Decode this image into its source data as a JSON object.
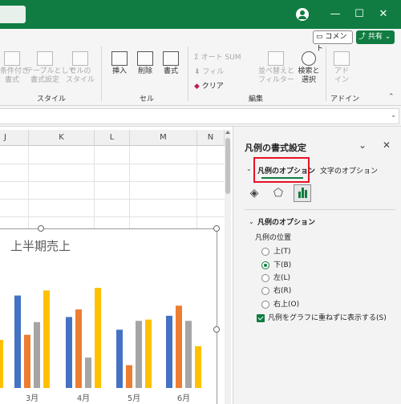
{
  "titlebar": {
    "minimize": "—",
    "maximize": "☐",
    "close": "✕"
  },
  "ribbon": {
    "comment_label": "コメント",
    "share_label": "共有",
    "items": {
      "conditional": "条件付き\n書式",
      "table": "テーブルとして\n書式設定",
      "cellstyle": "セルの\nスタイル",
      "insert": "挿入",
      "delete": "削除",
      "format": "書式",
      "autosum": "オート SUM",
      "fill": "フィル",
      "clear": "クリア",
      "sort": "並べ替えと\nフィルター",
      "find": "検索と\n選択",
      "addin": "アド\nイン"
    },
    "groups": {
      "style": "スタイル",
      "cells": "セル",
      "edit": "編集",
      "addin": "アドイン"
    }
  },
  "grid": {
    "columns": [
      "J",
      "K",
      "L",
      "M",
      "N"
    ]
  },
  "chart_data": {
    "type": "bar",
    "title": "上半期売上",
    "categories": [
      "3月",
      "4月",
      "5月",
      "6月"
    ],
    "series": [
      {
        "color": "#4472c4",
        "values": [
          730,
          560,
          460,
          570
        ]
      },
      {
        "color": "#ed7d31",
        "values": [
          420,
          620,
          180,
          650
        ]
      },
      {
        "color": "#a5a5a5",
        "values": [
          520,
          240,
          530,
          530
        ]
      },
      {
        "color": "#ffc000",
        "values": [
          770,
          790,
          540,
          330
        ]
      }
    ],
    "partial_series_left": {
      "color": "#ffc000",
      "value": 380
    },
    "ylim": [
      0,
      1000
    ]
  },
  "pane": {
    "title": "凡例の書式設定",
    "tab_legend": "凡例のオプション",
    "tab_text": "文字のオプション",
    "section_title": "凡例のオプション",
    "position_label": "凡例の位置",
    "options": [
      "上(T)",
      "下(B)",
      "左(L)",
      "右(R)",
      "右上(O)"
    ],
    "selected": "下(B)",
    "overlap_label": "凡例をグラフに重ねずに表示する(S)",
    "overlap_checked": true
  }
}
